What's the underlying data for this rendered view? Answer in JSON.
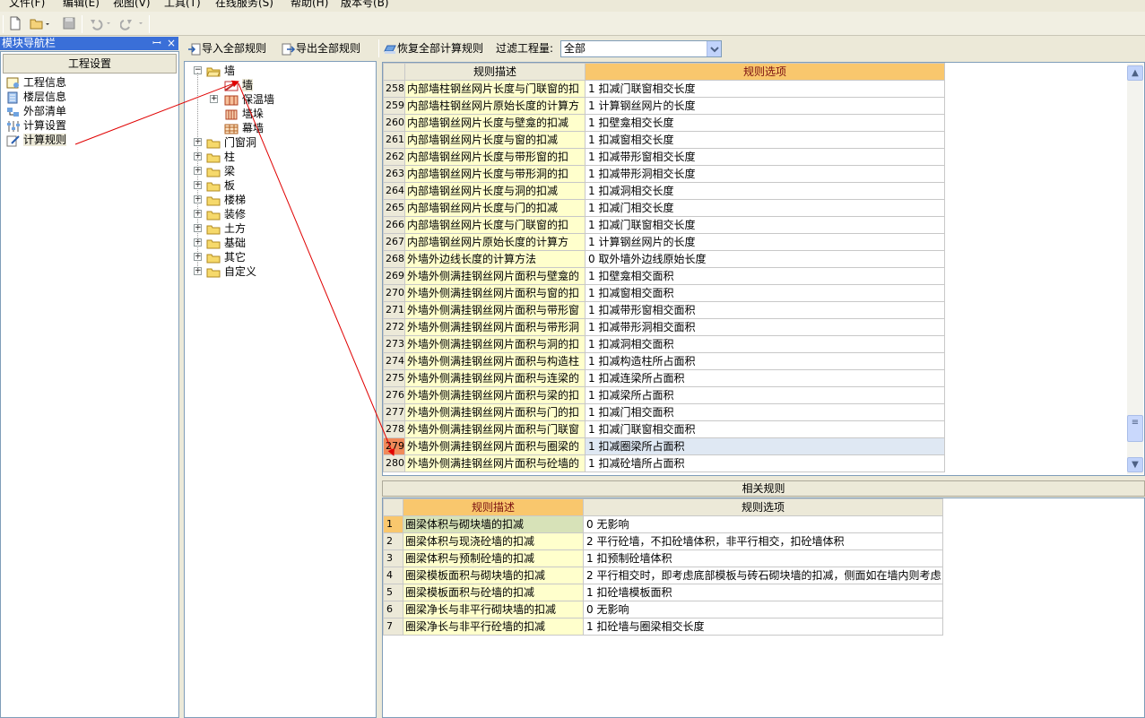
{
  "menu": [
    "文件(F)",
    "编辑(E)",
    "视图(V)",
    "工具(T)",
    "在线服务(S)",
    "帮助(H)",
    "版本号(B)"
  ],
  "nav": {
    "title": "模块导航栏",
    "pin_glyph": "ꟷ",
    "close_glyph": "×",
    "section": "工程设置",
    "items": [
      "工程信息",
      "楼层信息",
      "外部清单",
      "计算设置",
      "计算规则"
    ]
  },
  "tree_toolbar": {
    "import_label": "导入全部规则",
    "export_label": "导出全部规则"
  },
  "tree": {
    "root": "墙",
    "children": [
      "墙",
      "保温墙",
      "墙垛",
      "幕墙"
    ],
    "others": [
      "门窗洞",
      "柱",
      "梁",
      "板",
      "楼梯",
      "装修",
      "土方",
      "基础",
      "其它",
      "自定义"
    ]
  },
  "right_toolbar": {
    "restore_label": "恢复全部计算规则",
    "filter_label": "过滤工程量:",
    "filter_value": "全部"
  },
  "main_grid": {
    "col_desc": "规则描述",
    "col_opt": "规则选项",
    "selected_row": "279",
    "rows": [
      {
        "num": "258",
        "desc": "内部墙柱钢丝网片长度与门联窗的扣",
        "opt": "1   扣减门联窗相交长度"
      },
      {
        "num": "259",
        "desc": "内部墙柱钢丝网片原始长度的计算方",
        "opt": "1   计算钢丝网片的长度"
      },
      {
        "num": "260",
        "desc": "内部墙钢丝网片长度与壁龛的扣减",
        "opt": "1   扣壁龛相交长度"
      },
      {
        "num": "261",
        "desc": "内部墙钢丝网片长度与窗的扣减",
        "opt": "1   扣减窗相交长度"
      },
      {
        "num": "262",
        "desc": "内部墙钢丝网片长度与带形窗的扣",
        "opt": "1   扣减带形窗相交长度"
      },
      {
        "num": "263",
        "desc": "内部墙钢丝网片长度与带形洞的扣",
        "opt": "1   扣减带形洞相交长度"
      },
      {
        "num": "264",
        "desc": "内部墙钢丝网片长度与洞的扣减",
        "opt": "1   扣减洞相交长度"
      },
      {
        "num": "265",
        "desc": "内部墙钢丝网片长度与门的扣减",
        "opt": "1   扣减门相交长度"
      },
      {
        "num": "266",
        "desc": "内部墙钢丝网片长度与门联窗的扣",
        "opt": "1   扣减门联窗相交长度"
      },
      {
        "num": "267",
        "desc": "内部墙钢丝网片原始长度的计算方",
        "opt": "1   计算钢丝网片的长度"
      },
      {
        "num": "268",
        "desc": "外墙外边线长度的计算方法",
        "opt": "0   取外墙外边线原始长度"
      },
      {
        "num": "269",
        "desc": "外墙外侧满挂钢丝网片面积与壁龛的",
        "opt": "1   扣壁龛相交面积"
      },
      {
        "num": "270",
        "desc": "外墙外侧满挂钢丝网片面积与窗的扣",
        "opt": "1   扣减窗相交面积"
      },
      {
        "num": "271",
        "desc": "外墙外侧满挂钢丝网片面积与带形窗",
        "opt": "1   扣减带形窗相交面积"
      },
      {
        "num": "272",
        "desc": "外墙外侧满挂钢丝网片面积与带形洞",
        "opt": "1   扣减带形洞相交面积"
      },
      {
        "num": "273",
        "desc": "外墙外侧满挂钢丝网片面积与洞的扣",
        "opt": "1   扣减洞相交面积"
      },
      {
        "num": "274",
        "desc": "外墙外侧满挂钢丝网片面积与构造柱",
        "opt": "1   扣减构造柱所占面积"
      },
      {
        "num": "275",
        "desc": "外墙外侧满挂钢丝网片面积与连梁的",
        "opt": "1   扣减连梁所占面积"
      },
      {
        "num": "276",
        "desc": "外墙外侧满挂钢丝网片面积与梁的扣",
        "opt": "1   扣减梁所占面积"
      },
      {
        "num": "277",
        "desc": "外墙外侧满挂钢丝网片面积与门的扣",
        "opt": "1   扣减门相交面积"
      },
      {
        "num": "278",
        "desc": "外墙外侧满挂钢丝网片面积与门联窗",
        "opt": "1   扣减门联窗相交面积"
      },
      {
        "num": "279",
        "desc": "外墙外侧满挂钢丝网片面积与圈梁的",
        "opt": "1   扣减圈梁所占面积"
      },
      {
        "num": "280",
        "desc": "外墙外侧满挂钢丝网片面积与砼墙的",
        "opt": "1   扣减砼墙所占面积"
      }
    ]
  },
  "related": {
    "title": "相关规则",
    "col_desc": "规则描述",
    "col_opt": "规则选项",
    "rows": [
      {
        "num": "1",
        "desc": "圈梁体积与砌块墙的扣减",
        "opt": "0   无影响"
      },
      {
        "num": "2",
        "desc": "圈梁体积与现浇砼墙的扣减",
        "opt": "2 平行砼墙，不扣砼墙体积，非平行相交，扣砼墙体积"
      },
      {
        "num": "3",
        "desc": "圈梁体积与预制砼墙的扣减",
        "opt": "1 扣预制砼墙体积"
      },
      {
        "num": "4",
        "desc": "圈梁模板面积与砌块墙的扣减",
        "opt": "2 平行相交时，即考虑底部模板与砖石砌块墙的扣减，侧面如在墙内则考虑"
      },
      {
        "num": "5",
        "desc": "圈梁模板面积与砼墙的扣减",
        "opt": "1 扣砼墙模板面积"
      },
      {
        "num": "6",
        "desc": "圈梁净长与非平行砌块墙的扣减",
        "opt": "0   无影响"
      },
      {
        "num": "7",
        "desc": "圈梁净长与非平行砼墙的扣减",
        "opt": "1 扣砼墙与圈梁相交长度"
      }
    ]
  },
  "colors": {
    "accent": "#3a6fd8",
    "desc_bg": "#ffffcc",
    "header_orange": "#f9c76d",
    "arrow": "#e00000"
  }
}
